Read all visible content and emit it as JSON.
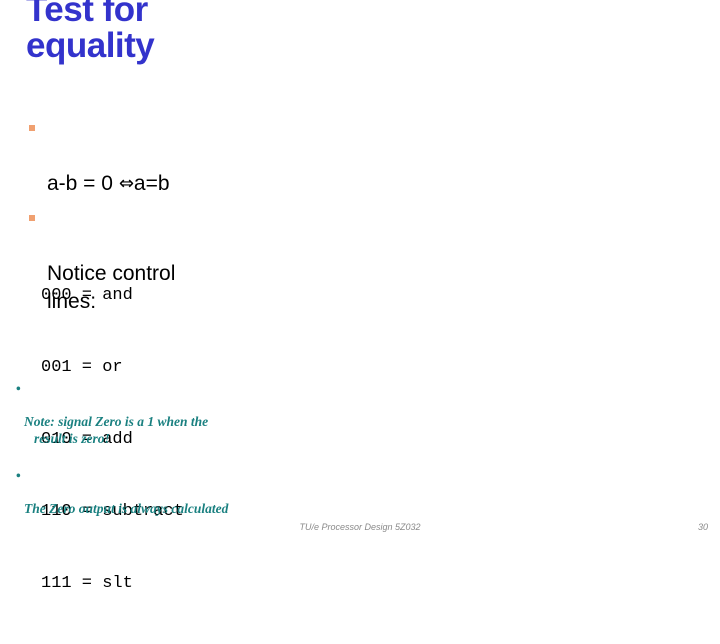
{
  "slide": {
    "title": "Test for\nequality",
    "title_color": "#3333cc",
    "background_color": "#ffffff"
  },
  "bullets": {
    "marker_color": "#f0a070",
    "items": [
      {
        "text_before": "a-b = 0 ",
        "arrow": "⇔",
        "text_after": "a=b"
      },
      {
        "text_before": "Notice control\nlines:",
        "arrow": "",
        "text_after": ""
      }
    ]
  },
  "code_block": {
    "rows": [
      {
        "code": "000",
        "eq": "=",
        "op": "and"
      },
      {
        "code": "001",
        "eq": "=",
        "op": "or"
      },
      {
        "code": "010",
        "eq": "=",
        "op": "add"
      },
      {
        "code": "110",
        "eq": "=",
        "op": "subtract"
      },
      {
        "code": "111",
        "eq": "=",
        "op": "slt"
      }
    ],
    "lines": [
      "000 = and",
      "001 = or",
      "010 = add",
      "110 = subtract",
      "111 = slt"
    ]
  },
  "notes": {
    "color": "#1a8080",
    "bullet_char": "•",
    "items": [
      {
        "line1": "Note:  signal Zero is a 1 when the",
        "line2": "result is zero!"
      },
      {
        "line1": "The Zero output is always calculated",
        "line2": ""
      }
    ]
  },
  "footer": {
    "text": "TU/e Processor Design 5Z032",
    "page_number": "30"
  }
}
